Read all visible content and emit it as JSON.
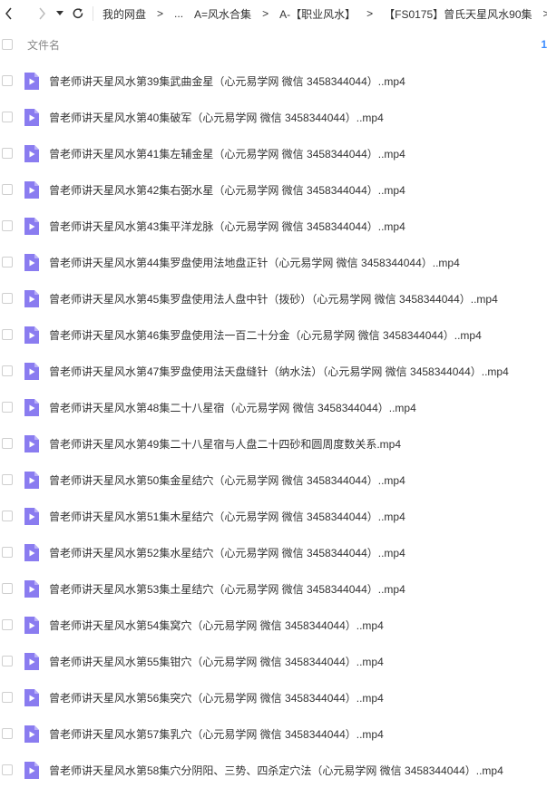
{
  "toolbar": {
    "back_icon": "chevron-left-icon",
    "forward_icon": "chevron-right-icon",
    "history_icon": "caret-down-icon",
    "refresh_icon": "refresh-icon",
    "breadcrumbs": [
      "我的网盘",
      "...",
      "A=风水合集",
      "A-【职业风水】",
      "【FS0175】曾氏天星风水90集"
    ],
    "separator": ">"
  },
  "header": {
    "column_label": "文件名",
    "count_fragment": "1"
  },
  "colors": {
    "accent": "#3b8cff",
    "video_icon": "#8a7cf0"
  },
  "files": [
    {
      "name": "曾老师讲天星风水第39集武曲金星（心元易学网 微信 3458344044）..mp4"
    },
    {
      "name": "曾老师讲天星风水第40集破军（心元易学网 微信 3458344044）..mp4"
    },
    {
      "name": "曾老师讲天星风水第41集左辅金星（心元易学网 微信 3458344044）..mp4"
    },
    {
      "name": "曾老师讲天星风水第42集右弼水星（心元易学网 微信 3458344044）..mp4"
    },
    {
      "name": "曾老师讲天星风水第43集平洋龙脉（心元易学网 微信 3458344044）..mp4"
    },
    {
      "name": "曾老师讲天星风水第44集罗盘使用法地盘正针（心元易学网 微信 3458344044）..mp4"
    },
    {
      "name": "曾老师讲天星风水第45集罗盘使用法人盘中针（拨砂）（心元易学网 微信 3458344044）..mp4"
    },
    {
      "name": "曾老师讲天星风水第46集罗盘使用法一百二十分金（心元易学网 微信 3458344044）..mp4"
    },
    {
      "name": "曾老师讲天星风水第47集罗盘使用法天盘缝针（纳水法）（心元易学网 微信 3458344044）..mp4"
    },
    {
      "name": "曾老师讲天星风水第48集二十八星宿（心元易学网 微信 3458344044）..mp4"
    },
    {
      "name": "曾老师讲天星风水第49集二十八星宿与人盘二十四砂和圆周度数关系.mp4"
    },
    {
      "name": "曾老师讲天星风水第50集金星结穴（心元易学网 微信 3458344044）..mp4"
    },
    {
      "name": "曾老师讲天星风水第51集木星结穴（心元易学网 微信 3458344044）..mp4"
    },
    {
      "name": "曾老师讲天星风水第52集水星结穴（心元易学网 微信 3458344044）..mp4"
    },
    {
      "name": "曾老师讲天星风水第53集土星结穴（心元易学网 微信 3458344044）..mp4"
    },
    {
      "name": "曾老师讲天星风水第54集窝穴（心元易学网 微信 3458344044）..mp4"
    },
    {
      "name": "曾老师讲天星风水第55集钳穴（心元易学网 微信 3458344044）..mp4"
    },
    {
      "name": "曾老师讲天星风水第56集突穴（心元易学网 微信 3458344044）..mp4"
    },
    {
      "name": "曾老师讲天星风水第57集乳穴（心元易学网 微信 3458344044）..mp4"
    },
    {
      "name": "曾老师讲天星风水第58集穴分阴阳、三势、四杀定穴法（心元易学网 微信 3458344044）..mp4"
    }
  ]
}
